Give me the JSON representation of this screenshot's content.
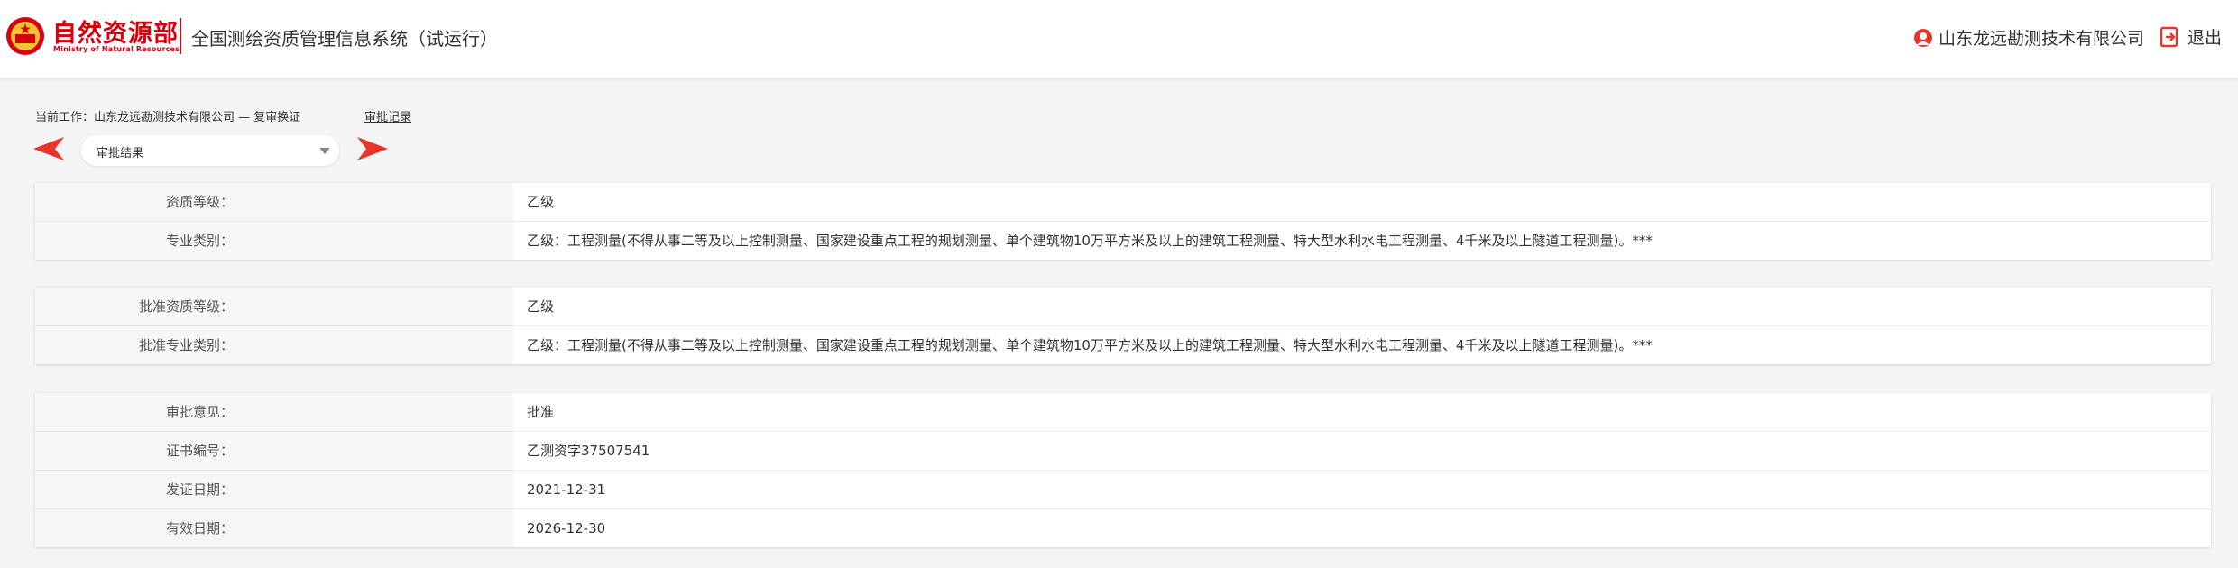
{
  "header": {
    "brand_cn": "自然资源部",
    "brand_en": "Ministry of Natural Resources",
    "system_title": "全国测绘资质管理信息系统（试运行）",
    "company": "山东龙远勘测技术有限公司",
    "logout": "退出"
  },
  "work": {
    "current": "当前工作：山东龙远勘测技术有限公司 — 复审换证",
    "record_link": "审批记录",
    "select_value": "审批结果"
  },
  "panel1": [
    {
      "label": "资质等级：",
      "value": "乙级"
    },
    {
      "label": "专业类别：",
      "value": "乙级：工程测量(不得从事二等及以上控制测量、国家建设重点工程的规划测量、单个建筑物10万平方米及以上的建筑工程测量、特大型水利水电工程测量、4千米及以上隧道工程测量)。***"
    }
  ],
  "panel2": [
    {
      "label": "批准资质等级：",
      "value": "乙级"
    },
    {
      "label": "批准专业类别：",
      "value": "乙级：工程测量(不得从事二等及以上控制测量、国家建设重点工程的规划测量、单个建筑物10万平方米及以上的建筑工程测量、特大型水利水电工程测量、4千米及以上隧道工程测量)。***"
    }
  ],
  "panel3": [
    {
      "label": "审批意见：",
      "value": "批准"
    },
    {
      "label": "证书编号：",
      "value": "乙测资字37507541"
    },
    {
      "label": "发证日期：",
      "value": "2021-12-31"
    },
    {
      "label": "有效日期：",
      "value": "2026-12-30"
    }
  ],
  "colors": {
    "brand_red": "#d7000f",
    "arrow_red": "#e8352b"
  }
}
